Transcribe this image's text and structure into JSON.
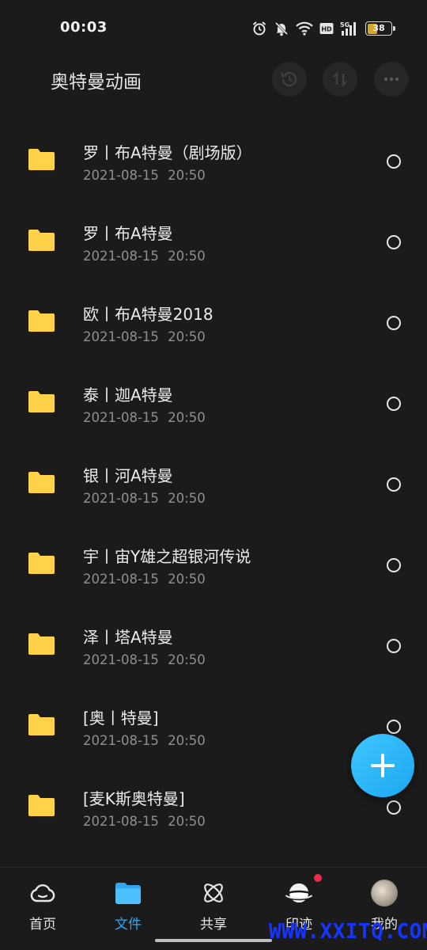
{
  "status_bar": {
    "time": "00:03",
    "battery": "38",
    "icons": [
      "alarm-icon",
      "mute-bell-icon",
      "wifi-icon",
      "hd-icon",
      "5g-signal-icon",
      "battery-icon"
    ]
  },
  "header": {
    "title": "奥特曼动画",
    "actions": [
      "history-icon",
      "sort-icon",
      "more-icon"
    ]
  },
  "files": [
    {
      "name": "罗丨布A特曼（剧场版）",
      "date": "2021-08-15  20:50"
    },
    {
      "name": "罗丨布A特曼",
      "date": "2021-08-15  20:50"
    },
    {
      "name": "欧丨布A特曼2018",
      "date": "2021-08-15  20:50"
    },
    {
      "name": "泰丨迦A特曼",
      "date": "2021-08-15  20:50"
    },
    {
      "name": "银丨河A特曼",
      "date": "2021-08-15  20:50"
    },
    {
      "name": "宇丨宙Y雄之超银河传说",
      "date": "2021-08-15  20:50"
    },
    {
      "name": "泽丨塔A特曼",
      "date": "2021-08-15  20:50"
    },
    {
      "name": "[奥丨特曼]",
      "date": "2021-08-15  20:50"
    },
    {
      "name": "[麦K斯奥特曼]",
      "date": "2021-08-15  20:50"
    }
  ],
  "nav": {
    "home": "首页",
    "files": "文件",
    "share": "共享",
    "footprint": "印迹",
    "mine": "我的",
    "active": "files"
  },
  "colors": {
    "background": "#1b1b1b",
    "folder": "#ffd24a",
    "accent": "#2fa8f0",
    "fab": "#29b6f6",
    "badge": "#ea2d4b"
  },
  "watermark": "WWW.XXITQ.COM"
}
